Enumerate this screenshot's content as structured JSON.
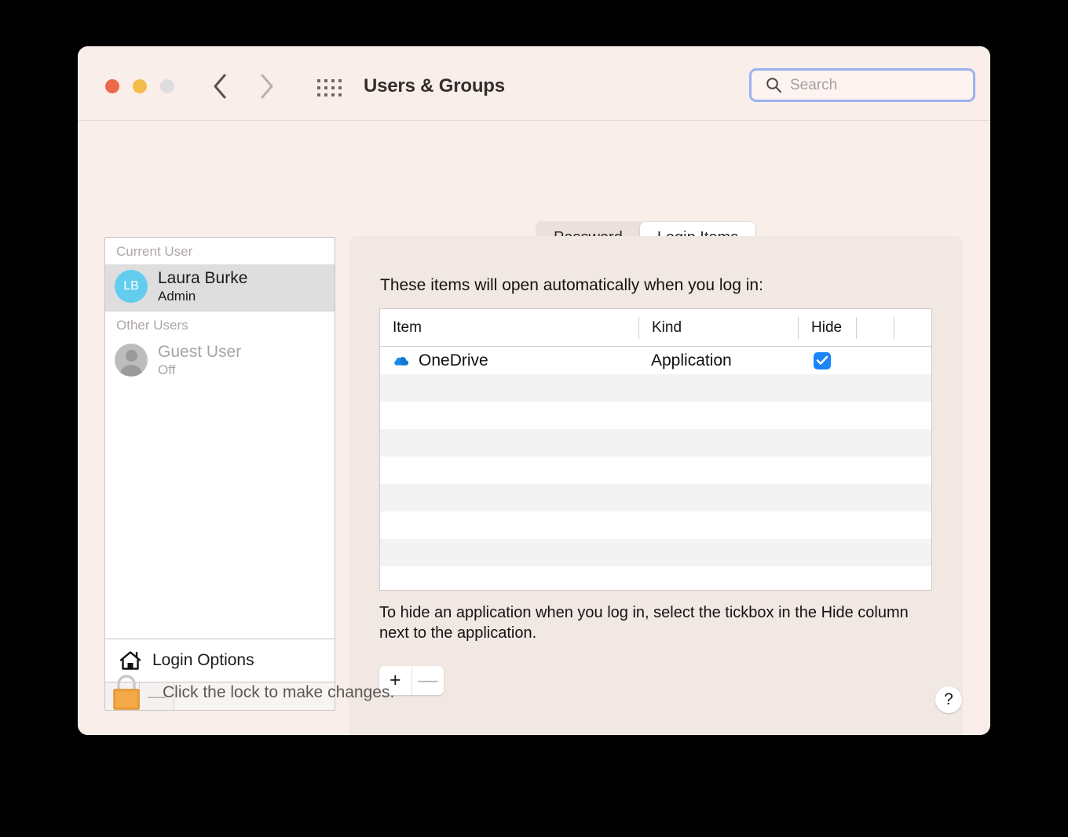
{
  "window": {
    "title": "Users & Groups",
    "traffic_lights": [
      "close-red",
      "minimize-yellow",
      "zoom-gray"
    ],
    "nav": {
      "back_icon": "chevron-left-icon",
      "forward_icon": "chevron-right-icon"
    },
    "grid_icon": "grid-view-icon"
  },
  "search": {
    "placeholder": "Search",
    "value": "",
    "icon": "search-icon",
    "focus_ring_color": "#9bb2ee"
  },
  "sidebar": {
    "groups": [
      {
        "label": "Current User",
        "users": [
          {
            "name": "Laura Burke",
            "status": "Admin",
            "initials": "LB",
            "avatar_color": "#63cdf0",
            "selected": true,
            "disabled": false
          }
        ]
      },
      {
        "label": "Other Users",
        "users": [
          {
            "name": "Guest User",
            "status": "Off",
            "initials": "",
            "avatar_color": "#bdbdbd",
            "selected": false,
            "disabled": true
          }
        ]
      }
    ],
    "login_options": {
      "label": "Login Options",
      "icon": "home-icon"
    },
    "footer": {
      "add_label": "+",
      "remove_label": "—",
      "enabled": false
    }
  },
  "tabs": [
    {
      "label": "Password",
      "active": false
    },
    {
      "label": "Login Items",
      "active": true
    }
  ],
  "main": {
    "heading": "These items will open automatically when you log in:",
    "table": {
      "columns": [
        "Item",
        "Kind",
        "Hide",
        "",
        ""
      ],
      "rows": [
        {
          "item": "OneDrive",
          "kind": "Application",
          "hide": true,
          "icon": "onedrive-cloud-icon"
        }
      ],
      "empty_row_count": 9
    },
    "hint": "To hide an application when you log in, select the tickbox in the Hide column next to the application.",
    "add_remove": {
      "add_label": "+",
      "remove_label": "—",
      "add_enabled": true,
      "remove_enabled": false
    }
  },
  "footer": {
    "lock_icon": "lock-closed-icon",
    "lock_text": "Click the lock to make changes.",
    "help_label": "?",
    "help_icon": "help-question-icon"
  },
  "colors": {
    "window_bg": "#faeeeb",
    "panel_bg": "#f1e7e3",
    "accent_blue": "#1b85f7",
    "checkbox_blue": "#1b85f7",
    "avatar_blue": "#63cdf0"
  }
}
